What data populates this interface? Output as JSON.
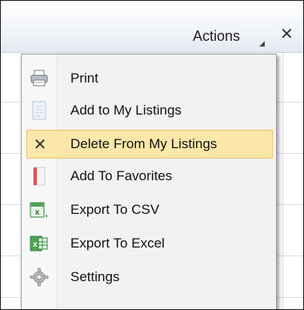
{
  "toolbar": {
    "actions_label": "Actions",
    "close_symbol": "✕"
  },
  "menu": {
    "items": [
      {
        "label": "Print",
        "icon": "printer-icon",
        "highlighted": false
      },
      {
        "label": "Add to My Listings",
        "icon": "document-icon",
        "highlighted": false
      },
      {
        "label": "Delete From My Listings",
        "icon": "close-icon",
        "highlighted": true,
        "symbol": "✕"
      },
      {
        "label": "Add To Favorites",
        "icon": "bookmark-icon",
        "highlighted": false
      },
      {
        "label": "Export To CSV",
        "icon": "csv-icon",
        "highlighted": false
      },
      {
        "label": "Export To Excel",
        "icon": "excel-icon",
        "highlighted": false
      },
      {
        "label": "Settings",
        "icon": "gear-icon",
        "highlighted": false
      }
    ]
  },
  "colors": {
    "highlight_bg": "#fbe7a8",
    "highlight_border": "#e3c46c",
    "menu_bg": "#f2f2f2"
  }
}
